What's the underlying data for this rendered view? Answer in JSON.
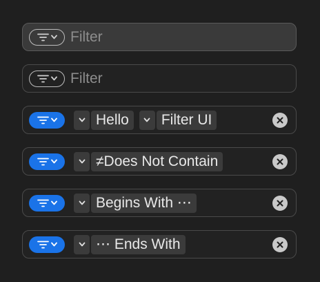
{
  "rows": [
    {
      "state": "focused-empty",
      "placeholder": "Filter"
    },
    {
      "state": "empty",
      "placeholder": "Filter"
    },
    {
      "state": "filled",
      "tokens": [
        "Hello",
        "Filter UI"
      ]
    },
    {
      "state": "filled",
      "tokens": [
        "≠Does Not Contain"
      ]
    },
    {
      "state": "filled",
      "tokens": [
        "Begins With ⋯"
      ]
    },
    {
      "state": "filled",
      "tokens": [
        "⋯ Ends With"
      ]
    }
  ],
  "icons": {
    "filter": "filter-lines-icon",
    "chevron": "chevron-down-icon",
    "clear": "clear-circle-x-icon"
  },
  "colors": {
    "accent": "#1a73e8",
    "background": "#1f1f1f",
    "token": "#3b3b3b"
  }
}
